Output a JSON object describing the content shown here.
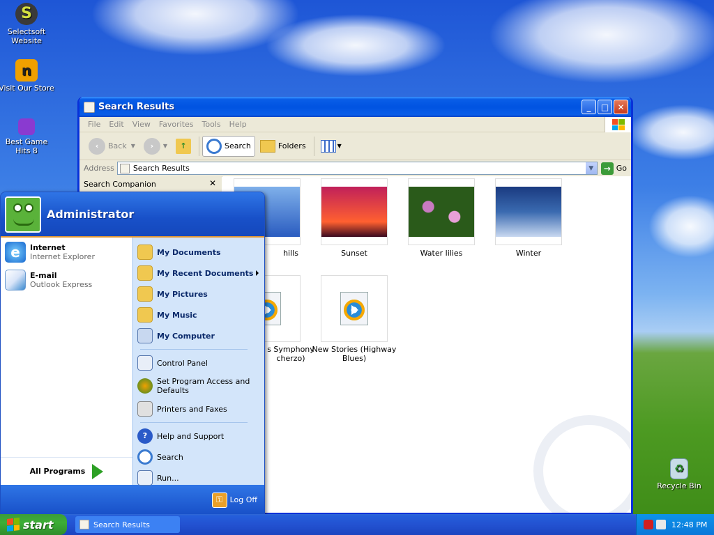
{
  "desktop": {
    "icons": [
      {
        "label": "Selectsoft Website"
      },
      {
        "label": "Visit Our Store"
      },
      {
        "label": "Best Game Hits 8"
      },
      {
        "label": "Recycle Bin"
      }
    ]
  },
  "window": {
    "title": "Search Results",
    "menu": [
      "File",
      "Edit",
      "View",
      "Favorites",
      "Tools",
      "Help"
    ],
    "toolbar": {
      "back": "Back",
      "search": "Search",
      "folders": "Folders"
    },
    "address": {
      "label": "Address",
      "value": "Search Results",
      "go": "Go"
    },
    "sidepane": {
      "title": "Search Companion"
    },
    "items": [
      {
        "label": "hills",
        "type": "image",
        "colors": [
          "#2a5cc0",
          "#7fb0ea"
        ]
      },
      {
        "label": "Sunset",
        "type": "image",
        "colors": [
          "#c0205a",
          "#ff6030"
        ]
      },
      {
        "label": "Water lilies",
        "type": "image",
        "colors": [
          "#2a5a1a",
          "#c87ac0"
        ]
      },
      {
        "label": "Winter",
        "type": "image",
        "colors": [
          "#1a3a80",
          "#c8d8f0"
        ]
      },
      {
        "label": "s Symphony\ncherzo)",
        "type": "audio"
      },
      {
        "label": "New Stories (Highway Blues)",
        "type": "audio"
      }
    ]
  },
  "startmenu": {
    "user": "Administrator",
    "pinned": [
      {
        "title": "Internet",
        "sub": "Internet Explorer"
      },
      {
        "title": "E-mail",
        "sub": "Outlook Express"
      }
    ],
    "all_programs": "All Programs",
    "right": [
      {
        "label": "My Documents",
        "bold": true,
        "icon": "folder-icon"
      },
      {
        "label": "My Recent Documents",
        "bold": true,
        "icon": "recent-docs-icon",
        "submenu": true
      },
      {
        "label": "My Pictures",
        "bold": true,
        "icon": "pictures-icon"
      },
      {
        "label": "My Music",
        "bold": true,
        "icon": "music-icon"
      },
      {
        "label": "My Computer",
        "bold": true,
        "icon": "computer-icon"
      },
      {
        "label": "Control Panel",
        "icon": "control-panel-icon"
      },
      {
        "label": "Set Program Access and Defaults",
        "icon": "program-access-icon"
      },
      {
        "label": "Printers and Faxes",
        "icon": "printer-icon"
      },
      {
        "label": "Help and Support",
        "icon": "help-icon"
      },
      {
        "label": "Search",
        "icon": "search-icon"
      },
      {
        "label": "Run...",
        "icon": "run-icon"
      }
    ],
    "logoff": "Log Off"
  },
  "taskbar": {
    "start": "start",
    "task": "Search Results",
    "clock": "12:48 PM"
  }
}
